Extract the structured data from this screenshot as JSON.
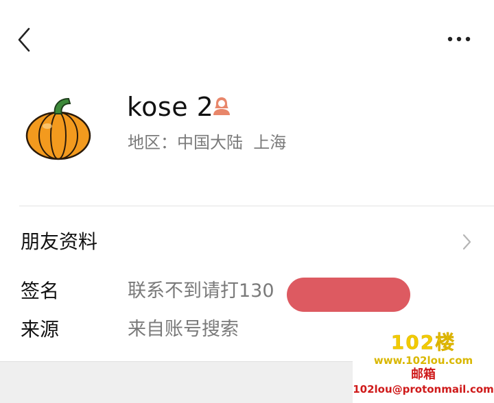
{
  "header": {
    "back_icon": "chevron-left-icon",
    "more_icon": "ellipsis-icon"
  },
  "profile": {
    "avatar_icon": "pumpkin-avatar",
    "nickname": "kose 2",
    "gender_icon": "female-user-icon",
    "region": "地区：中国大陆  上海"
  },
  "friend_info": {
    "label": "朋友资料",
    "chevron_icon": "chevron-right-icon"
  },
  "rows": [
    {
      "label": "签名",
      "value": "联系不到请打130"
    },
    {
      "label": "来源",
      "value": "来自账号搜索"
    }
  ],
  "colors": {
    "redaction": "#dd5a61",
    "gender": "#e8866a"
  },
  "watermark": {
    "logo": "102楼",
    "url": "www.102lou.com",
    "mail_title": "邮箱",
    "mail": "102lou@protonmail.com"
  }
}
